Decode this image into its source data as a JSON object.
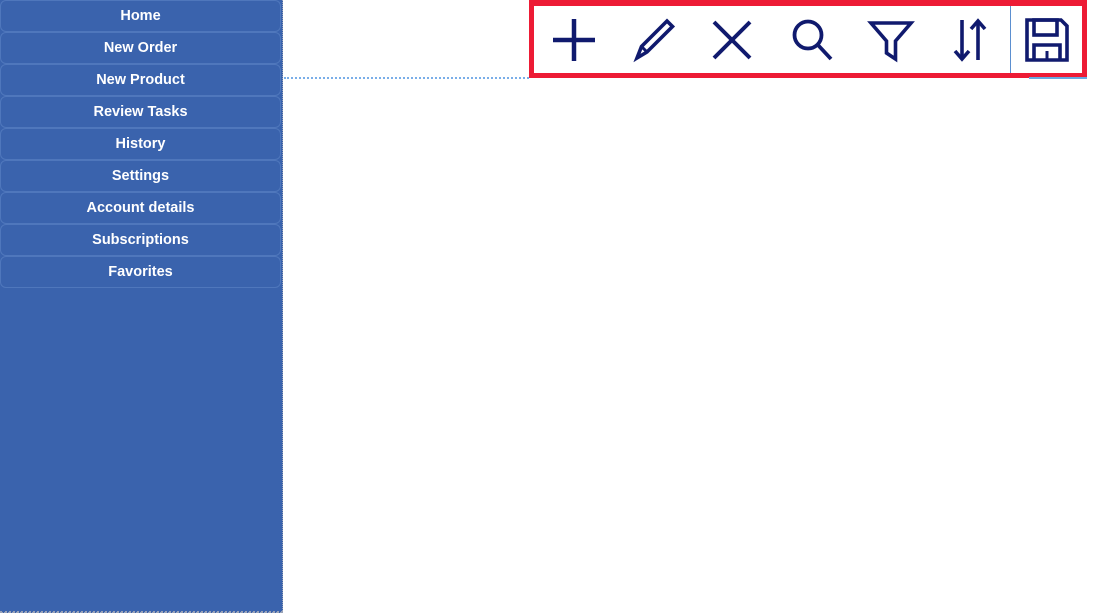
{
  "theme": {
    "sidebar_bg": "#3A63AD",
    "sidebar_item_border": "#4F77BC",
    "sidebar_text": "#FFFFFF",
    "icon_color": "#101A6E",
    "highlight_border": "#ED1B35",
    "content_bg": "#FFFFFF",
    "divider_dotted": "#7AAEE8",
    "save_cell_border": "#5B8FD0"
  },
  "sidebar": {
    "items": [
      {
        "label": "Home",
        "name": "sidebar-item-home"
      },
      {
        "label": "New Order",
        "name": "sidebar-item-new-order"
      },
      {
        "label": "New Product",
        "name": "sidebar-item-new-product"
      },
      {
        "label": "Review Tasks",
        "name": "sidebar-item-review-tasks"
      },
      {
        "label": "History",
        "name": "sidebar-item-history"
      },
      {
        "label": "Settings",
        "name": "sidebar-item-settings"
      },
      {
        "label": "Account details",
        "name": "sidebar-item-account-details"
      },
      {
        "label": "Subscriptions",
        "name": "sidebar-item-subscriptions"
      },
      {
        "label": "Favorites",
        "name": "sidebar-item-favorites"
      }
    ]
  },
  "toolbar": {
    "highlighted": true,
    "buttons": [
      {
        "label": "Add",
        "icon": "plus-icon"
      },
      {
        "label": "Edit",
        "icon": "pencil-icon"
      },
      {
        "label": "Delete",
        "icon": "close-x-icon"
      },
      {
        "label": "Search",
        "icon": "search-icon"
      },
      {
        "label": "Filter",
        "icon": "filter-funnel-icon"
      },
      {
        "label": "Sort",
        "icon": "sort-arrows-icon"
      }
    ],
    "save_button": {
      "label": "Save",
      "icon": "save-floppy-icon"
    }
  },
  "main": {
    "body_text": ""
  }
}
